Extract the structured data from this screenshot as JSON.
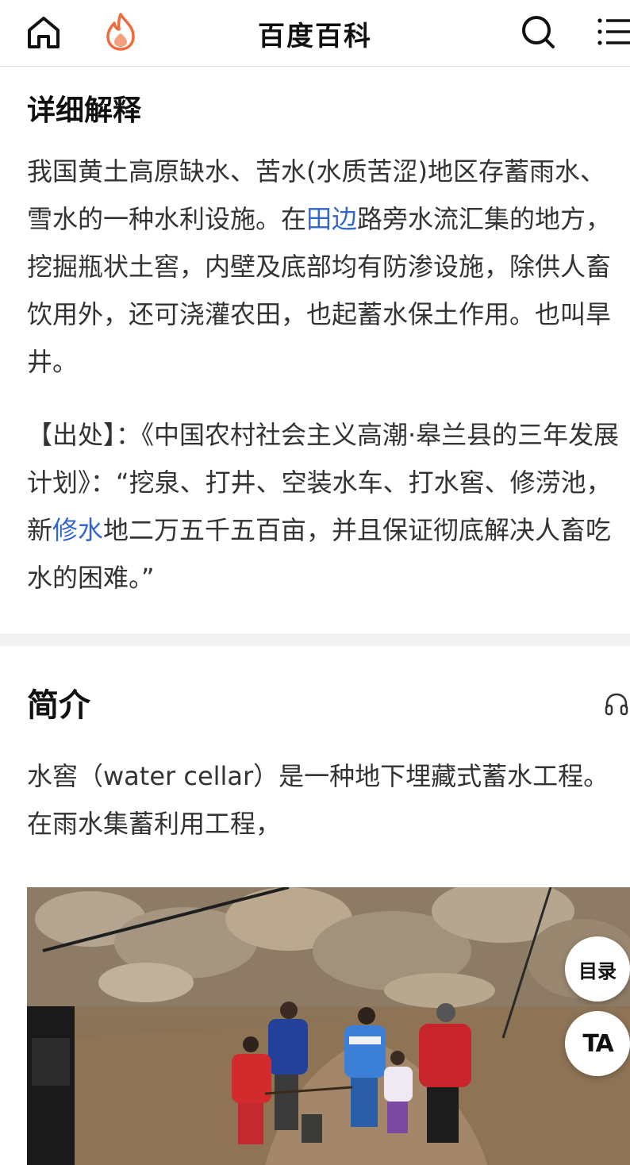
{
  "header": {
    "title": "百度百科",
    "icons": [
      "home-icon",
      "flame-icon",
      "search-icon",
      "menu-icon"
    ]
  },
  "detail": {
    "heading": "详细解释",
    "text_pre": "我国黄土高原缺水、苦水(水质苦涩)地区存蓄雨水、雪水的一种水利设施。在",
    "link1": "田边",
    "text_post": "路旁水流汇集的地方，挖掘瓶状土窖，内壁及底部均有防渗设施，除供人畜饮用外，还可浇灌农田，也起蓄水保土作用。也叫旱井。",
    "source_pre": "【出处】：《中国农村社会主义高潮·皋兰县的三年发展计划》：“挖泉、打井、空装水车、打水窖、修涝池，新",
    "link2": "修水",
    "source_post": "地二万五千五百亩，并且保证彻底解决人畜吃水的困难。”"
  },
  "intro": {
    "heading": "简介",
    "text": "水窖（water cellar）是一种地下埋藏式蓄水工程。在雨水集蓄利用工程，",
    "audio_icon": "headphone-icon"
  },
  "floating": {
    "toc_label": "目录",
    "ta_label": "TA"
  },
  "colors": {
    "link": "#3366cc",
    "flame": "#f06a3b",
    "divider": "#f2f2f2"
  }
}
